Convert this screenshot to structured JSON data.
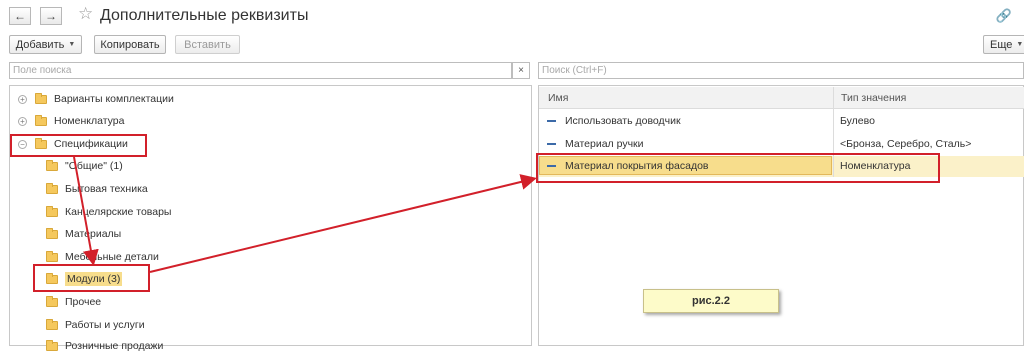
{
  "header": {
    "back_icon": "arrow-left-icon",
    "forward_icon": "arrow-right-icon",
    "favorite_icon": "star-icon",
    "title": "Дополнительные реквизиты",
    "link_icon": "link-icon"
  },
  "toolbar": {
    "add_label": "Добавить",
    "copy_label": "Копировать",
    "paste_label": "Вставить",
    "more_label": "Еще"
  },
  "tree": {
    "search_placeholder": "Поле поиска",
    "clear_label": "×",
    "items": [
      {
        "label": "Варианты комплектации"
      },
      {
        "label": "Номенклатура"
      },
      {
        "label": "Спецификации"
      },
      {
        "label": "\"Общие\" (1)"
      },
      {
        "label": "Бытовая техника"
      },
      {
        "label": "Канцелярские товары"
      },
      {
        "label": "Материалы"
      },
      {
        "label": "Мебельные детали"
      },
      {
        "label": "Модули (3)"
      },
      {
        "label": "Прочее"
      },
      {
        "label": "Работы и услуги"
      },
      {
        "label": "Розничные продажи"
      }
    ]
  },
  "grid": {
    "search_placeholder": "Поиск (Ctrl+F)",
    "columns": [
      "Имя",
      "Тип значения"
    ],
    "rows": [
      {
        "name": "Использовать доводчик",
        "type": "Булево"
      },
      {
        "name": "Материал ручки",
        "type": "<Бронза, Серебро, Сталь>"
      },
      {
        "name": "Материал покрытия фасадов",
        "type": "Номенклатура"
      }
    ]
  },
  "annotation": {
    "caption": "рис.2.2",
    "color": "#d2202a"
  }
}
